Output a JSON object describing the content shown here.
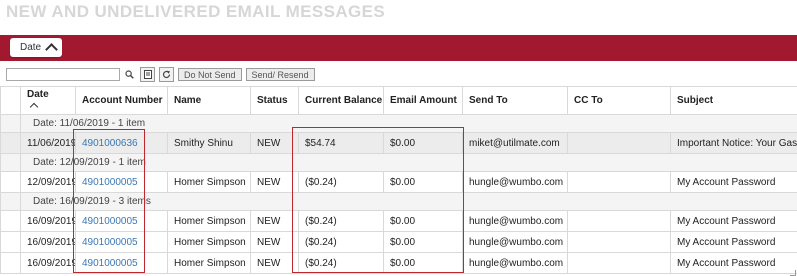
{
  "page": {
    "title": "NEW AND UNDELIVERED EMAIL MESSAGES"
  },
  "grouping": {
    "chip_label": "Date"
  },
  "toolbar": {
    "search_placeholder": "",
    "search_value": "",
    "do_not_send_label": "Do Not Send",
    "send_resend_label": "Send/ Resend"
  },
  "columns": [
    "Date",
    "Account Number",
    "Name",
    "Status",
    "Current Balance",
    "Email Amount",
    "Send To",
    "CC To",
    "Subject"
  ],
  "groups": [
    {
      "label": "Date: 11/06/2019 - 1 item",
      "rows": [
        {
          "date": "11/06/2019",
          "account": "4901000636",
          "name": "Smithy Shinu",
          "status": "NEW",
          "balance": "$54.74",
          "amount": "$0.00",
          "send_to": "miket@utilmate.com",
          "cc_to": "",
          "subject": "Important Notice: Your Gas Serv",
          "selected": true
        }
      ]
    },
    {
      "label": "Date: 12/09/2019 - 1 item",
      "rows": [
        {
          "date": "12/09/2019",
          "account": "4901000005",
          "name": "Homer Simpson",
          "status": "NEW",
          "balance": "($0.24)",
          "amount": "$0.00",
          "send_to": "hungle@wumbo.com",
          "cc_to": "",
          "subject": "My Account Password",
          "selected": false
        }
      ]
    },
    {
      "label": "Date: 16/09/2019 - 3 items",
      "rows": [
        {
          "date": "16/09/2019",
          "account": "4901000005",
          "name": "Homer Simpson",
          "status": "NEW",
          "balance": "($0.24)",
          "amount": "$0.00",
          "send_to": "hungle@wumbo.com",
          "cc_to": "",
          "subject": "My Account Password",
          "selected": false
        },
        {
          "date": "16/09/2019",
          "account": "4901000005",
          "name": "Homer Simpson",
          "status": "NEW",
          "balance": "($0.24)",
          "amount": "$0.00",
          "send_to": "hungle@wumbo.com",
          "cc_to": "",
          "subject": "My Account Password",
          "selected": false
        },
        {
          "date": "16/09/2019",
          "account": "4901000005",
          "name": "Homer Simpson",
          "status": "NEW",
          "balance": "($0.24)",
          "amount": "$0.00",
          "send_to": "hungle@wumbo.com",
          "cc_to": "",
          "subject": "My Account Password",
          "selected": false
        }
      ]
    }
  ],
  "icons": {
    "search": "search-icon",
    "export": "document-icon",
    "refresh": "refresh-icon",
    "collapse": "collapse-triangle-icon",
    "sort": "sort-ascending-icon"
  },
  "colors": {
    "accent_bar": "#a2182f",
    "link": "#3a78b4",
    "highlight_box": "#c0262d",
    "title": "#d6d6d6"
  }
}
